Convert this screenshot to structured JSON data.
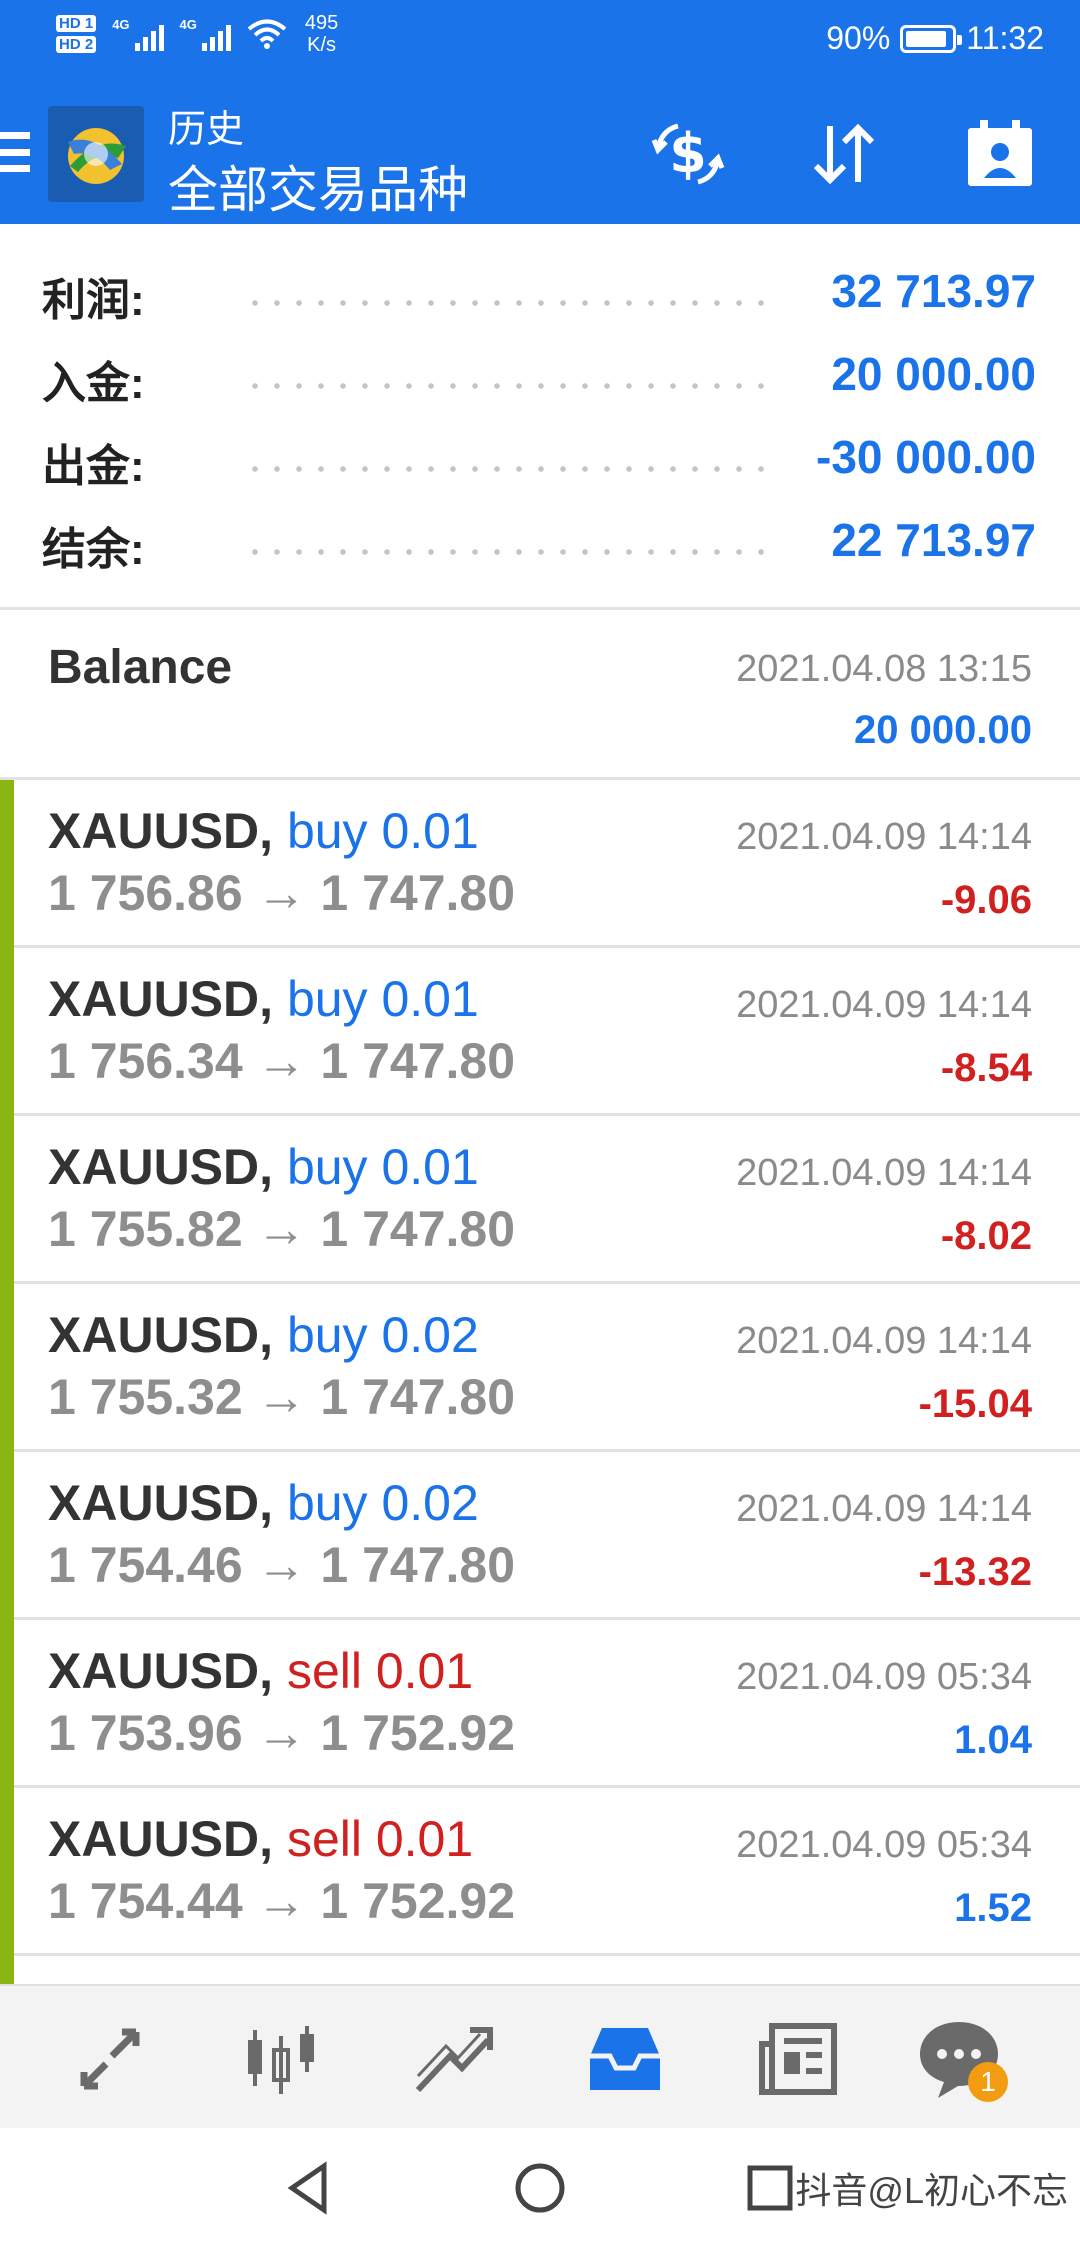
{
  "status_bar": {
    "hd1": "HD 1",
    "hd2": "HD 2",
    "net1": "4G",
    "net2": "4G",
    "speed_value": "495",
    "speed_unit": "K/s",
    "battery": "90%",
    "battery_level": 0.9,
    "time": "11:32"
  },
  "app_bar": {
    "title_small": "历史",
    "title_big": "全部交易品种"
  },
  "summary": [
    {
      "label": "利润:",
      "value": "32 713.97"
    },
    {
      "label": "入金:",
      "value": "20 000.00"
    },
    {
      "label": "出金:",
      "value": "-30 000.00"
    },
    {
      "label": "结余:",
      "value": "22 713.97"
    }
  ],
  "balance_entry": {
    "name": "Balance",
    "time": "2021.04.08 13:15",
    "amount": "20 000.00"
  },
  "trades": [
    {
      "symbol": "XAUUSD,",
      "side": "buy 0.01",
      "prices": "1 756.86 → 1 747.80",
      "time": "2021.04.09 14:14",
      "profit": "-9.06"
    },
    {
      "symbol": "XAUUSD,",
      "side": "buy 0.01",
      "prices": "1 756.34 → 1 747.80",
      "time": "2021.04.09 14:14",
      "profit": "-8.54"
    },
    {
      "symbol": "XAUUSD,",
      "side": "buy 0.01",
      "prices": "1 755.82 → 1 747.80",
      "time": "2021.04.09 14:14",
      "profit": "-8.02"
    },
    {
      "symbol": "XAUUSD,",
      "side": "buy 0.02",
      "prices": "1 755.32 → 1 747.80",
      "time": "2021.04.09 14:14",
      "profit": "-15.04"
    },
    {
      "symbol": "XAUUSD,",
      "side": "buy 0.02",
      "prices": "1 754.46 → 1 747.80",
      "time": "2021.04.09 14:14",
      "profit": "-13.32"
    },
    {
      "symbol": "XAUUSD,",
      "side": "sell 0.01",
      "prices": "1 753.96 → 1 752.92",
      "time": "2021.04.09 05:34",
      "profit": "1.04"
    },
    {
      "symbol": "XAUUSD,",
      "side": "sell 0.01",
      "prices": "1 754.44 → 1 752.92",
      "time": "2021.04.09 05:34",
      "profit": "1.52"
    }
  ],
  "bottom_nav": {
    "icons": [
      "quotes-icon",
      "chart-icon",
      "trade-icon",
      "history-icon",
      "news-icon",
      "chat-icon"
    ],
    "chat_badge": "1",
    "active": "history-icon"
  },
  "watermark": "抖音@L初心不忘",
  "colors": {
    "primary": "#1a73e8",
    "negative": "#d02020",
    "row_bar": "#8bb512"
  }
}
